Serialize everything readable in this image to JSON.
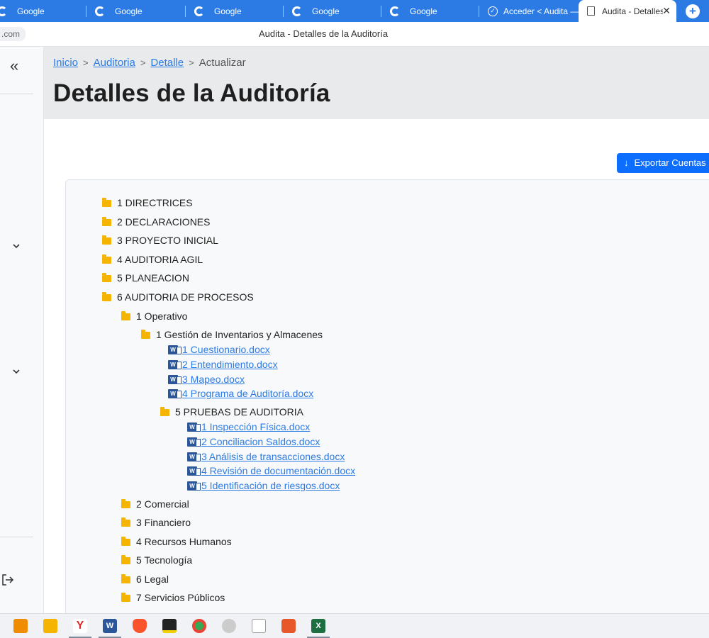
{
  "tabs": [
    {
      "label": "Google"
    },
    {
      "label": "Google"
    },
    {
      "label": "Google"
    },
    {
      "label": "Google"
    },
    {
      "label": "Google"
    },
    {
      "label": "Acceder < Audita —"
    },
    {
      "label": "Audita - Detalles"
    }
  ],
  "address": {
    "url_fragment": ".com",
    "window_title": "Audita - Detalles de la Auditoría"
  },
  "breadcrumb": {
    "items": [
      "Inicio",
      "Auditoria",
      "Detalle"
    ],
    "current": "Actualizar",
    "separator": ">"
  },
  "page": {
    "title": "Detalles de la Auditoría"
  },
  "actions": {
    "export_label": "Exportar Cuentas"
  },
  "tree": [
    {
      "label": "1 DIRECTRICES",
      "type": "folder"
    },
    {
      "label": "2 DECLARACIONES",
      "type": "folder"
    },
    {
      "label": "3 PROYECTO INICIAL",
      "type": "folder"
    },
    {
      "label": "4 AUDITORIA AGIL",
      "type": "folder"
    },
    {
      "label": "5 PLANEACION",
      "type": "folder"
    },
    {
      "label": "6 AUDITORIA DE PROCESOS",
      "type": "folder"
    },
    {
      "label": "1 Operativo",
      "type": "folder"
    },
    {
      "label": "1 Gestión de Inventarios y Almacenes",
      "type": "folder"
    },
    {
      "label": " 1 Cuestionario.docx",
      "type": "file"
    },
    {
      "label": " 2 Entendimiento.docx",
      "type": "file"
    },
    {
      "label": " 3 Mapeo.docx",
      "type": "file"
    },
    {
      "label": " 4 Programa de Auditoría.docx",
      "type": "file"
    },
    {
      "label": "5 PRUEBAS DE AUDITORIA",
      "type": "folder"
    },
    {
      "label": " 1 Inspección Física.docx",
      "type": "file"
    },
    {
      "label": " 2 Conciliacion Saldos.docx",
      "type": "file"
    },
    {
      "label": " 3 Análisis de transacciones.docx",
      "type": "file"
    },
    {
      "label": " 4 Revisión de documentación.docx",
      "type": "file"
    },
    {
      "label": " 5 Identificación de riesgos.docx",
      "type": "file"
    },
    {
      "label": "2 Comercial",
      "type": "folder"
    },
    {
      "label": "3 Financiero",
      "type": "folder"
    },
    {
      "label": "4 Recursos Humanos",
      "type": "folder"
    },
    {
      "label": "5 Tecnología",
      "type": "folder"
    },
    {
      "label": "6 Legal",
      "type": "folder"
    },
    {
      "label": "7 Servicios Públicos",
      "type": "folder"
    }
  ],
  "icons": {
    "sidebar_collapse": "double-chevron-left-icon",
    "sidebar_expand": "chevron-down-icon",
    "logout": "logout-icon",
    "folder": "folder-icon",
    "word": "word-document-icon",
    "export": "arrow-down-icon"
  },
  "colors": {
    "tab_strip": "#2c7be5",
    "link": "#2c7be5",
    "primary_button": "#0d6efd",
    "folder": "#f4b400",
    "word": "#2b579a",
    "header_bg": "#e8eaec"
  },
  "taskbar": {
    "apps": [
      {
        "icon": "lightbulb-app-icon",
        "color": "#f08c00"
      },
      {
        "icon": "file-explorer-icon",
        "color": "#f4b400"
      },
      {
        "icon": "yandex-browser-icon",
        "color": "#e0292b",
        "glyph": "Y"
      },
      {
        "icon": "word-app-icon",
        "color": "#2b579a",
        "glyph": "W"
      },
      {
        "icon": "brave-browser-icon",
        "color": "#fb542b"
      },
      {
        "icon": "sticky-notes-icon",
        "color": "#222222"
      },
      {
        "icon": "chrome-icon",
        "color": "#34a853"
      },
      {
        "icon": "settings-app-icon",
        "color": "#888888"
      },
      {
        "icon": "blank-file-icon",
        "color": "#ffffff"
      },
      {
        "icon": "burst-app-icon",
        "color": "#e8572a"
      },
      {
        "icon": "excel-app-icon",
        "color": "#1d6f42",
        "glyph": "X"
      }
    ]
  }
}
